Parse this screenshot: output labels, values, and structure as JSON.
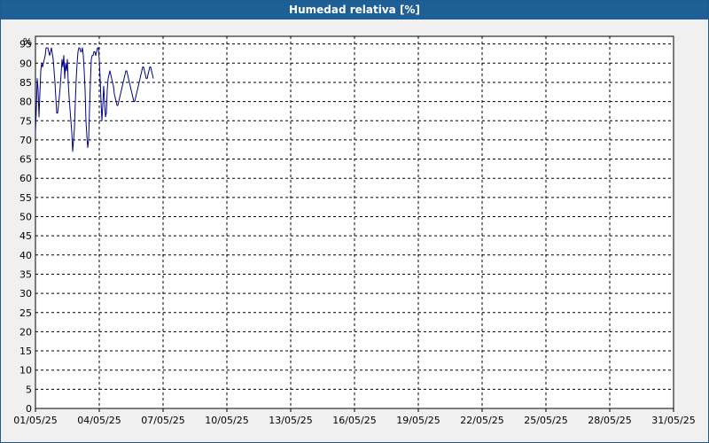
{
  "window": {
    "title": "Humedad relativa [%]"
  },
  "chart_data": {
    "type": "line",
    "title": "Humedad relativa [%]",
    "y_unit_label": "%",
    "ylim": [
      0,
      97
    ],
    "y_ticks": [
      0,
      5,
      10,
      15,
      20,
      25,
      30,
      35,
      40,
      45,
      50,
      55,
      60,
      65,
      70,
      75,
      80,
      85,
      90,
      95
    ],
    "xlim": [
      "01/05/25",
      "31/05/25"
    ],
    "x_tick_labels": [
      "01/05/25",
      "04/05/25",
      "07/05/25",
      "10/05/25",
      "13/05/25",
      "16/05/25",
      "19/05/25",
      "22/05/25",
      "25/05/25",
      "28/05/25",
      "31/05/25"
    ],
    "grid": true,
    "legend": "none",
    "colors": {
      "series": "#00008b",
      "grid": "#000000",
      "title_bar": "#1e5f96"
    },
    "series": [
      {
        "x": [
          "2025-05-01 00:00",
          "2025-05-01 01:00",
          "2025-05-01 02:00",
          "2025-05-01 03:00",
          "2025-05-01 04:00",
          "2025-05-01 05:00",
          "2025-05-01 06:00",
          "2025-05-01 07:00",
          "2025-05-01 08:00",
          "2025-05-01 09:00",
          "2025-05-01 10:00",
          "2025-05-01 11:00",
          "2025-05-01 12:00",
          "2025-05-01 14:00",
          "2025-05-01 16:00",
          "2025-05-01 18:00",
          "2025-05-01 20:00",
          "2025-05-01 22:00",
          "2025-05-02 00:00",
          "2025-05-02 01:00",
          "2025-05-02 02:00",
          "2025-05-02 04:00",
          "2025-05-02 06:00",
          "2025-05-02 07:00",
          "2025-05-02 08:00",
          "2025-05-02 09:00",
          "2025-05-02 10:00",
          "2025-05-02 11:00",
          "2025-05-02 12:00",
          "2025-05-02 13:00",
          "2025-05-02 14:00",
          "2025-05-02 16:00",
          "2025-05-02 17:00",
          "2025-05-02 18:00",
          "2025-05-02 19:00",
          "2025-05-02 20:00",
          "2025-05-02 21:00",
          "2025-05-02 22:00",
          "2025-05-02 23:00",
          "2025-05-03 00:00",
          "2025-05-03 01:00",
          "2025-05-03 02:00",
          "2025-05-03 03:00",
          "2025-05-03 04:00",
          "2025-05-03 05:00",
          "2025-05-03 06:00",
          "2025-05-03 07:00",
          "2025-05-03 08:00",
          "2025-05-03 09:00",
          "2025-05-03 10:00",
          "2025-05-03 11:00",
          "2025-05-03 12:00",
          "2025-05-03 13:00",
          "2025-05-03 14:00",
          "2025-05-03 15:00",
          "2025-05-03 16:00",
          "2025-05-03 17:00",
          "2025-05-03 18:00",
          "2025-05-03 19:00",
          "2025-05-03 20:00",
          "2025-05-03 21:00",
          "2025-05-03 22:00",
          "2025-05-03 23:00",
          "2025-05-04 00:00",
          "2025-05-04 01:00",
          "2025-05-04 02:00",
          "2025-05-04 03:00",
          "2025-05-04 04:00",
          "2025-05-04 05:00",
          "2025-05-04 06:00",
          "2025-05-04 07:00",
          "2025-05-04 08:00",
          "2025-05-04 09:00",
          "2025-05-04 10:00",
          "2025-05-04 11:00",
          "2025-05-04 12:00",
          "2025-05-04 13:00",
          "2025-05-04 14:00",
          "2025-05-04 15:00",
          "2025-05-04 16:00",
          "2025-05-04 17:00",
          "2025-05-04 18:00",
          "2025-05-04 19:00",
          "2025-05-04 20:00",
          "2025-05-04 21:00",
          "2025-05-04 22:00",
          "2025-05-04 23:00",
          "2025-05-05 00:00",
          "2025-05-05 01:00",
          "2025-05-05 02:00",
          "2025-05-05 03:00",
          "2025-05-05 04:00",
          "2025-05-05 05:00",
          "2025-05-05 06:00",
          "2025-05-05 07:00",
          "2025-05-05 08:00",
          "2025-05-05 09:00",
          "2025-05-05 10:00",
          "2025-05-05 11:00",
          "2025-05-05 12:00",
          "2025-05-05 13:00",
          "2025-05-05 14:00",
          "2025-05-05 15:00",
          "2025-05-05 16:00",
          "2025-05-05 17:00",
          "2025-05-05 18:00",
          "2025-05-05 19:00",
          "2025-05-05 20:00",
          "2025-05-05 21:00",
          "2025-05-05 22:00",
          "2025-05-05 23:00",
          "2025-05-06 00:00",
          "2025-05-06 01:00",
          "2025-05-06 02:00",
          "2025-05-06 03:00",
          "2025-05-06 04:00",
          "2025-05-06 05:00",
          "2025-05-06 06:00",
          "2025-05-06 07:00",
          "2025-05-06 08:00",
          "2025-05-06 09:00",
          "2025-05-06 10:00",
          "2025-05-06 11:00",
          "2025-05-06 12:00",
          "2025-05-06 13:00"
        ],
        "y": [
          72,
          78,
          86,
          83,
          76,
          82,
          88,
          90,
          89,
          90,
          91,
          92,
          94,
          94,
          92,
          94,
          91,
          85,
          77,
          77,
          79,
          84,
          91,
          89,
          92,
          86,
          90,
          88,
          91,
          85,
          81,
          75,
          72,
          67,
          70,
          73,
          80,
          86,
          90,
          93,
          94,
          94,
          93,
          93,
          94,
          92,
          88,
          83,
          75,
          71,
          68,
          70,
          78,
          85,
          91,
          92,
          92,
          93,
          93,
          92,
          93,
          94,
          94,
          91,
          86,
          80,
          75,
          79,
          84,
          80,
          76,
          77,
          83,
          86,
          87,
          88,
          87,
          86,
          85,
          84,
          82,
          81,
          80,
          79,
          79,
          80,
          81,
          82,
          83,
          84,
          85,
          86,
          87,
          88,
          88,
          87,
          86,
          85,
          84,
          83,
          82,
          81,
          80,
          80,
          81,
          82,
          83,
          84,
          85,
          86,
          87,
          88,
          89,
          89,
          88,
          87,
          86,
          86,
          87,
          88,
          89,
          89,
          88,
          87,
          86
        ]
      }
    ]
  }
}
